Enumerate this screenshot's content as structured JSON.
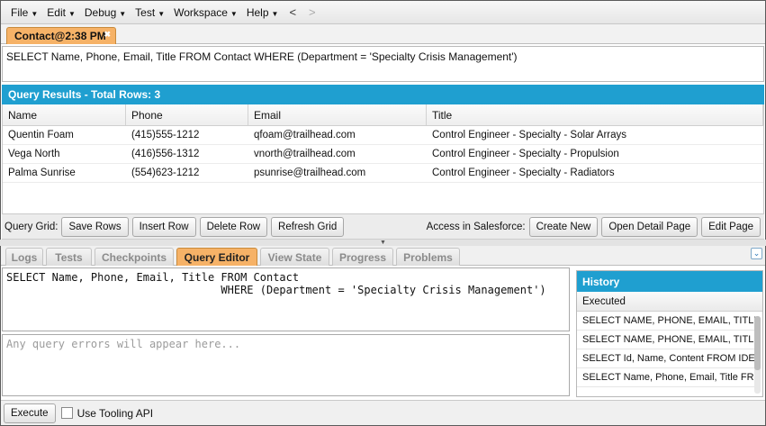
{
  "menu": {
    "items": [
      "File",
      "Edit",
      "Debug",
      "Test",
      "Workspace",
      "Help"
    ],
    "back_arrow": "<",
    "forward_arrow": ">"
  },
  "top_tab": {
    "label": "Contact@2:38 PM",
    "close": "✖"
  },
  "query_line": "SELECT Name, Phone, Email, Title FROM Contact WHERE (Department = 'Specialty Crisis Management')",
  "results": {
    "header": "Query Results - Total Rows: 3",
    "columns": [
      "Name",
      "Phone",
      "Email",
      "Title"
    ],
    "rows": [
      [
        "Quentin Foam",
        "(415)555-1212",
        "qfoam@trailhead.com",
        "Control Engineer - Specialty - Solar Arrays"
      ],
      [
        "Vega North",
        "(416)556-1312",
        "vnorth@trailhead.com",
        "Control Engineer - Specialty - Propulsion"
      ],
      [
        "Palma Sunrise",
        "(554)623-1212",
        "psunrise@trailhead.com",
        "Control Engineer - Specialty - Radiators"
      ]
    ]
  },
  "grid_toolbar": {
    "label": "Query Grid:",
    "save_rows": "Save Rows",
    "insert_row": "Insert Row",
    "delete_row": "Delete Row",
    "refresh_grid": "Refresh Grid",
    "access_label": "Access in Salesforce:",
    "create_new": "Create New",
    "open_detail_page": "Open Detail Page",
    "edit_page": "Edit Page"
  },
  "bottom_tabs": [
    "Logs",
    "Tests",
    "Checkpoints",
    "Query Editor",
    "View State",
    "Progress",
    "Problems"
  ],
  "active_bottom_tab": "Query Editor",
  "editor": {
    "line1": "SELECT Name, Phone, Email, Title FROM Contact",
    "line2": "                                 WHERE (Department = 'Specialty Crisis Management')",
    "errors_placeholder": "Any query errors will appear here..."
  },
  "history": {
    "title": "History",
    "subheader": "Executed",
    "items": [
      "SELECT NAME, PHONE, EMAIL, TITLE...",
      "SELECT NAME, PHONE, EMAIL, TITLE...",
      "SELECT Id, Name, Content FROM IDE...",
      "SELECT Name, Phone, Email, Title FR..."
    ]
  },
  "bottom_bar": {
    "execute": "Execute",
    "tooling_label": "Use Tooling API",
    "tooling_checked": false
  },
  "colors": {
    "accent_blue": "#1f9fd0",
    "active_tab_orange": "#f6b267"
  }
}
